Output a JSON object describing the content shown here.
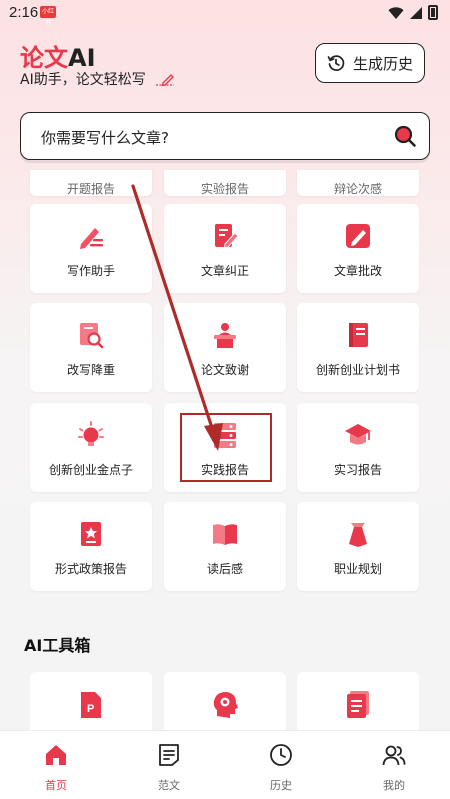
{
  "status": {
    "time": "2:16",
    "badge": "小红书"
  },
  "header": {
    "title_accent": "论文",
    "title_rest": "AI",
    "subtitle": "AI助手，论文轻松写",
    "history_button": "生成历史"
  },
  "search": {
    "placeholder": "你需要写什么文章?"
  },
  "grid": {
    "partial_row": [
      "开题报告",
      "实验报告",
      "辩论次感"
    ],
    "items": [
      {
        "label": "写作助手",
        "icon": "pencil-lines-icon"
      },
      {
        "label": "文章纠正",
        "icon": "doc-edit-icon"
      },
      {
        "label": "文章批改",
        "icon": "check-edit-icon"
      },
      {
        "label": "改写降重",
        "icon": "doc-search-icon"
      },
      {
        "label": "论文致谢",
        "icon": "podium-icon"
      },
      {
        "label": "创新创业计划书",
        "icon": "book-icon"
      },
      {
        "label": "创新创业金点子",
        "icon": "lightbulb-icon"
      },
      {
        "label": "实践报告",
        "icon": "server-icon"
      },
      {
        "label": "实习报告",
        "icon": "graduation-cap-icon"
      },
      {
        "label": "形式政策报告",
        "icon": "star-doc-icon"
      },
      {
        "label": "读后感",
        "icon": "open-book-icon"
      },
      {
        "label": "职业规划",
        "icon": "tie-icon"
      }
    ]
  },
  "tools": {
    "title": "AI工具箱",
    "items": [
      {
        "icon": "ppt-icon"
      },
      {
        "icon": "brain-head-icon"
      },
      {
        "icon": "list-doc-icon"
      }
    ]
  },
  "nav": [
    {
      "label": "首页",
      "icon": "home-icon",
      "active": true
    },
    {
      "label": "范文",
      "icon": "template-icon",
      "active": false
    },
    {
      "label": "历史",
      "icon": "clock-icon",
      "active": false
    },
    {
      "label": "我的",
      "icon": "user-icon",
      "active": false
    }
  ],
  "colors": {
    "accent": "#e8384b",
    "annotation": "#b12a2a"
  }
}
